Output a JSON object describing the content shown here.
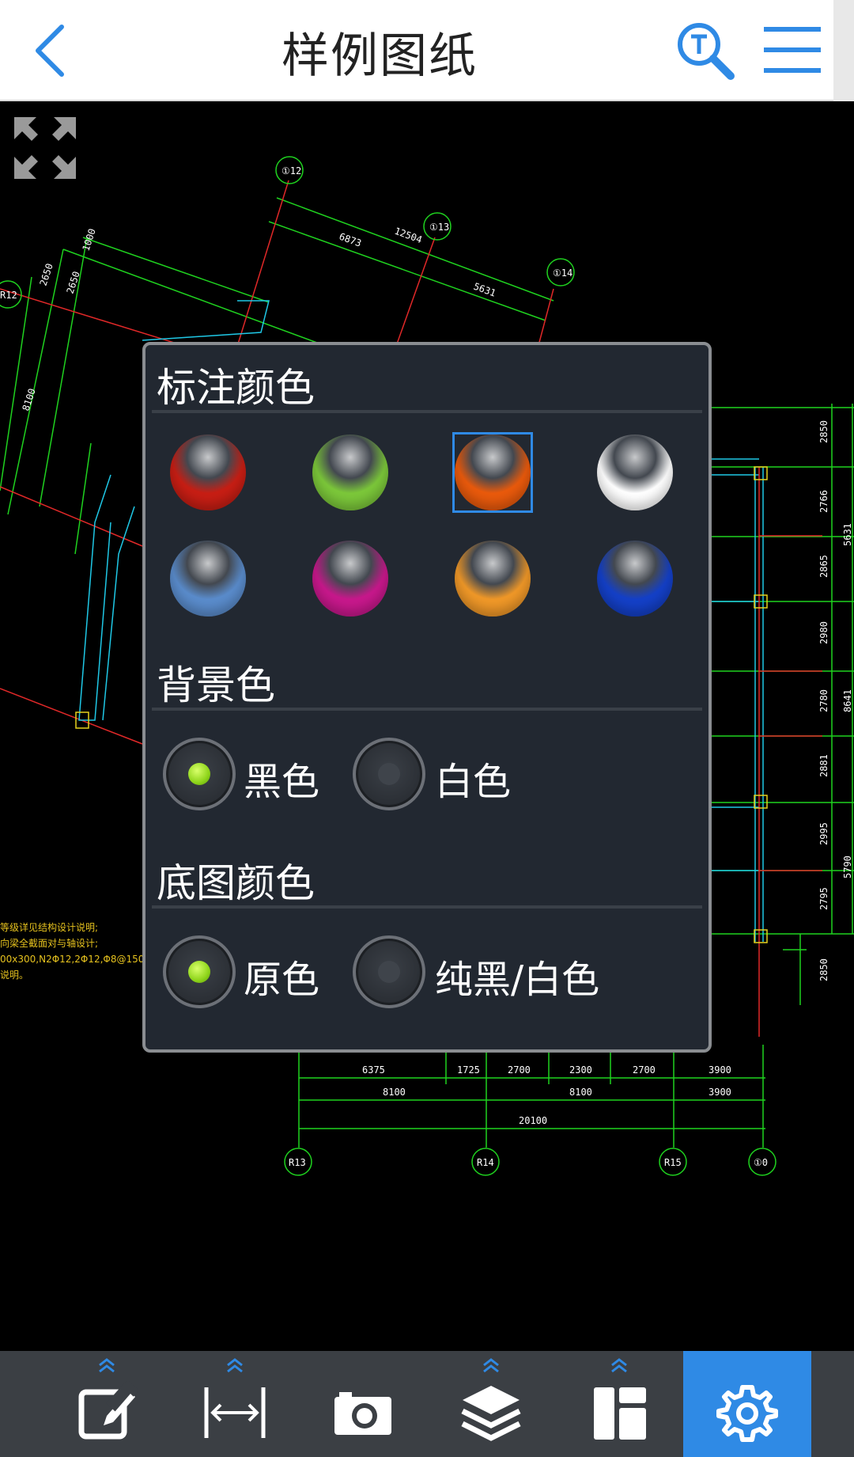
{
  "header": {
    "title": "样例图纸",
    "back_icon": "chevron-left-icon",
    "search_icon": "text-search-icon",
    "menu_icon": "hamburger-menu-icon"
  },
  "drawing": {
    "axis_labels": [
      "①12",
      "①13",
      "①14",
      "R12",
      "R13",
      "R14",
      "R15",
      "①0"
    ],
    "dims_top": [
      "12504",
      "6873",
      "5631"
    ],
    "dims_left": [
      "1000",
      "2650",
      "2650",
      "8100"
    ],
    "dims_bottom_row1": [
      "6375",
      "1725",
      "2700",
      "2300",
      "2700",
      "3900"
    ],
    "dims_bottom_row2": [
      "8100",
      "8100",
      "3900"
    ],
    "dims_bottom_total": "20100",
    "dims_right": [
      "2850",
      "2766",
      "2865",
      "2980",
      "2780",
      "2881",
      "2995",
      "2795",
      "2850"
    ],
    "dims_right_total": [
      "5631",
      "8641",
      "5790"
    ]
  },
  "panel": {
    "annotation_color_title": "标注颜色",
    "annotation_colors": [
      {
        "name": "red",
        "color": "#c81e14",
        "selected": false
      },
      {
        "name": "green",
        "color": "#7cc83a",
        "selected": false
      },
      {
        "name": "orange-red",
        "color": "#ea5a0c",
        "selected": true
      },
      {
        "name": "white",
        "color": "#ffffff",
        "selected": false
      },
      {
        "name": "light-blue",
        "color": "#5a8ccc",
        "selected": false
      },
      {
        "name": "magenta",
        "color": "#c8188c",
        "selected": false
      },
      {
        "name": "orange",
        "color": "#f09828",
        "selected": false
      },
      {
        "name": "blue",
        "color": "#1440c8",
        "selected": false
      }
    ],
    "background_title": "背景色",
    "background_options": [
      {
        "label": "黑色",
        "selected": true
      },
      {
        "label": "白色",
        "selected": false
      }
    ],
    "base_color_title": "底图颜色",
    "base_color_options": [
      {
        "label": "原色",
        "selected": true
      },
      {
        "label": "纯黑/白色",
        "selected": false
      }
    ]
  },
  "toolbar": {
    "items": [
      {
        "name": "annotate",
        "icon": "edit-note-icon",
        "has_expand": true,
        "active": false
      },
      {
        "name": "measure",
        "icon": "measure-distance-icon",
        "has_expand": true,
        "active": false
      },
      {
        "name": "camera",
        "icon": "camera-icon",
        "has_expand": false,
        "active": false
      },
      {
        "name": "layers",
        "icon": "layers-icon",
        "has_expand": true,
        "active": false
      },
      {
        "name": "layout",
        "icon": "layout-icon",
        "has_expand": true,
        "active": false
      },
      {
        "name": "settings",
        "icon": "gear-icon",
        "has_expand": false,
        "active": true
      }
    ],
    "accent": "#2f8ae5"
  }
}
